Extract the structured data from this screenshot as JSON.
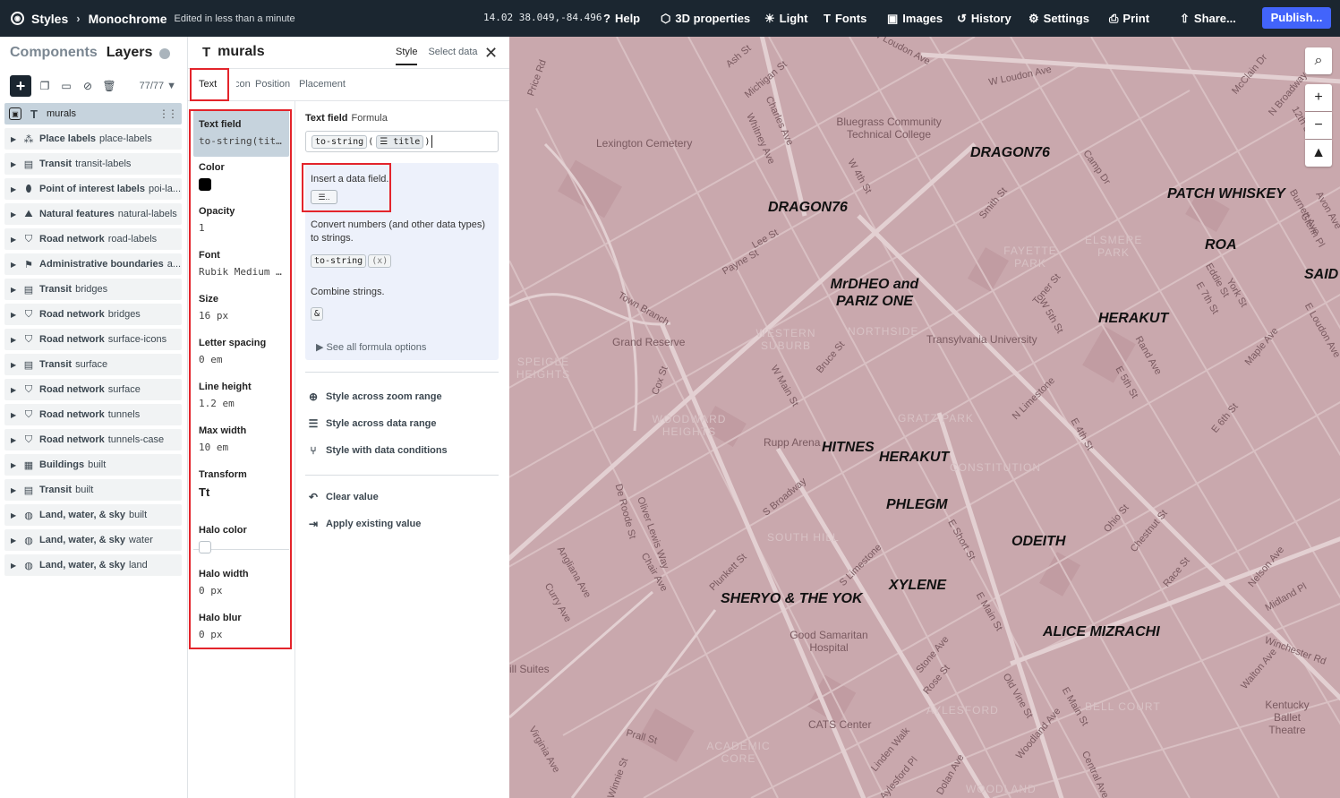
{
  "topbar": {
    "styles_label": "Styles",
    "style_name": "Monochrome",
    "edited": "Edited in less than a minute",
    "coords": "14.02 38.049,-84.496",
    "nav": [
      {
        "icon": "help-icon",
        "glyph": "?",
        "label": "Help"
      },
      {
        "icon": "cube-icon",
        "glyph": "⬡",
        "label": "3D properties"
      },
      {
        "icon": "sun-icon",
        "glyph": "☀",
        "label": "Light"
      },
      {
        "icon": "font-icon",
        "glyph": "T",
        "label": "Fonts"
      },
      {
        "icon": "image-icon",
        "glyph": "▣",
        "label": "Images"
      },
      {
        "icon": "history-icon",
        "glyph": "↺",
        "label": "History"
      },
      {
        "icon": "gear-icon",
        "glyph": "⚙",
        "label": "Settings"
      },
      {
        "icon": "print-icon",
        "glyph": "⎙",
        "label": "Print"
      },
      {
        "icon": "share-icon",
        "glyph": "⇧",
        "label": "Share..."
      }
    ],
    "publish": "Publish..."
  },
  "left": {
    "tab_components": "Components",
    "tab_layers": "Layers",
    "layer_count": "77/77",
    "layers": [
      {
        "icon": "text-icon",
        "group": "",
        "name": "murals",
        "selected": true
      },
      {
        "icon": "place-icon",
        "group": "Place labels",
        "name": "place-labels"
      },
      {
        "icon": "transit-icon",
        "group": "Transit",
        "name": "transit-labels"
      },
      {
        "icon": "pin-icon",
        "group": "Point of interest labels",
        "name": "poi-la..."
      },
      {
        "icon": "mountain-icon",
        "group": "Natural features",
        "name": "natural-labels"
      },
      {
        "icon": "road-icon",
        "group": "Road network",
        "name": "road-labels"
      },
      {
        "icon": "flag-icon",
        "group": "Administrative boundaries",
        "name": "a..."
      },
      {
        "icon": "transit-icon",
        "group": "Transit",
        "name": "bridges"
      },
      {
        "icon": "road-icon",
        "group": "Road network",
        "name": "bridges"
      },
      {
        "icon": "road-icon",
        "group": "Road network",
        "name": "surface-icons"
      },
      {
        "icon": "transit-icon",
        "group": "Transit",
        "name": "surface"
      },
      {
        "icon": "road-icon",
        "group": "Road network",
        "name": "surface"
      },
      {
        "icon": "road-icon",
        "group": "Road network",
        "name": "tunnels"
      },
      {
        "icon": "road-icon",
        "group": "Road network",
        "name": "tunnels-case"
      },
      {
        "icon": "building-icon",
        "group": "Buildings",
        "name": "built"
      },
      {
        "icon": "transit-icon",
        "group": "Transit",
        "name": "built"
      },
      {
        "icon": "globe-icon",
        "group": "Land, water, & sky",
        "name": "built"
      },
      {
        "icon": "globe-icon",
        "group": "Land, water, & sky",
        "name": "water"
      },
      {
        "icon": "globe-icon",
        "group": "Land, water, & sky",
        "name": "land"
      }
    ]
  },
  "editor": {
    "title": "murals",
    "tab_style": "Style",
    "tab_select_data": "Select data",
    "subtabs": [
      "Text",
      "Icon",
      "Position",
      "Placement"
    ],
    "props": [
      {
        "label": "Text field",
        "value": "to-string(titl..."
      },
      {
        "label": "Color",
        "value": ""
      },
      {
        "label": "Opacity",
        "value": "1"
      },
      {
        "label": "Font",
        "value": "Rubik Medium I..."
      },
      {
        "label": "Size",
        "value": "16 px"
      },
      {
        "label": "Letter spacing",
        "value": "0 em"
      },
      {
        "label": "Line height",
        "value": "1.2 em"
      },
      {
        "label": "Max width",
        "value": "10 em"
      },
      {
        "label": "Transform",
        "value": "Tt"
      },
      {
        "label": "Halo color",
        "value": ""
      },
      {
        "label": "Halo width",
        "value": "0 px"
      },
      {
        "label": "Halo blur",
        "value": "0 px"
      }
    ],
    "color_value": "#000000",
    "halo_color_value": "#ffffff",
    "value_editor": {
      "header_field": "Text field",
      "header_mode": "Formula",
      "formula_fn": "to-string",
      "formula_arg": "title",
      "insert_hint": "Insert a data field.",
      "convert_hint": "Convert numbers (and other data types) to strings.",
      "convert_chip": "to-string",
      "convert_arg": "(x)",
      "combine_hint": "Combine strings.",
      "combine_chip": "&",
      "see_all": "See all formula options",
      "zoom_range": "Style across zoom range",
      "data_range": "Style across data range",
      "data_conditions": "Style with data conditions",
      "clear": "Clear value",
      "apply_existing": "Apply existing value"
    }
  },
  "map": {
    "streets": [
      "W Loudon Ave",
      "W Loudon Ave",
      "Ash St",
      "Michigan St",
      "Price Rd",
      "Charles Ave",
      "Whitney Ave",
      "W 4th St",
      "Smith St",
      "Lee St",
      "Payne St",
      "Town Branch",
      "Cox St",
      "W Main St",
      "Bruce St",
      "Toner St",
      "W 5th St",
      "E 5th St",
      "E 7th St",
      "Eddie St",
      "York St",
      "Maple Ave",
      "N Broadway",
      "McClain Dr",
      "12th St",
      "Avon Ave",
      "Glenn Pl",
      "Burnett Ave",
      "E Loudon Ave",
      "Rand Ave",
      "N Limestone",
      "E 4th St",
      "E 6th St",
      "De Roode St",
      "Oliver Lewis Way",
      "Chair Ave",
      "S Broadway",
      "Plunkett St",
      "S Limestone",
      "E Short St",
      "Ohio St",
      "Chestnut St",
      "Race St",
      "Nelson Ave",
      "Midland Pl",
      "Angliana Ave",
      "Curry Ave",
      "E Main St",
      "Stone Ave",
      "Rose St",
      "Old Vine St",
      "E Main St",
      "Walton Ave",
      "Winchester Rd",
      "Woodland Ave",
      "Linden Walk",
      "Prall St",
      "Virginia Ave",
      "Aylesford Pl",
      "Winnie St",
      "Central Ave",
      "Dolan Ave",
      "Camp Dr"
    ],
    "places": [
      "Lexington Cemetery",
      "Bluegrass Community Technical College",
      "Grand Reserve",
      "Transylvania University",
      "Rupp Arena",
      "Good Samaritan Hospital",
      "CATS Center",
      "Kentucky Ballet Theatre",
      "ill Suites"
    ],
    "areas": [
      "FAYETTE PARK",
      "ELSMERE PARK",
      "SPEIGLE HEIGHTS",
      "WESTERN SUBURB",
      "NORTHSIDE",
      "WOODWARD HEIGHTS",
      "GRATZ PARK",
      "CONSTITUTION",
      "SOUTH HILL",
      "AYLESFORD",
      "BELL COURT",
      "ACADEMIC CORE",
      "WOODLAND"
    ],
    "murals": [
      "DRAGON76",
      "DRAGON76",
      "PATCH WHISKEY",
      "ROA",
      "SAID",
      "MrDHEO and PARIZ ONE",
      "HERAKUT",
      "HITNES",
      "HERAKUT",
      "PHLEGM",
      "ODEITH",
      "XYLENE",
      "SHERYO & THE YOK",
      "ALICE MIZRACHI"
    ],
    "controls": [
      "search-icon",
      "zoom-in-icon",
      "zoom-out-icon",
      "compass-icon"
    ],
    "colors": {
      "land": "#c9a8ad",
      "road": "#ddc6c9",
      "park": "#b8949a",
      "block": "#c19ca2"
    }
  },
  "colors": {
    "topbar": "#1b2630",
    "accent": "#4264fb",
    "selected": "#c6d3dd",
    "highlight": "#e3242b"
  }
}
